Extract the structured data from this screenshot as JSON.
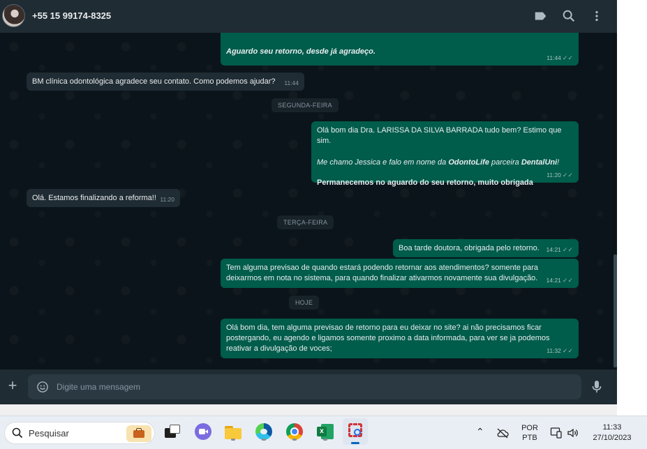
{
  "header": {
    "contact_name": "+55 15 99174-8325",
    "icons": [
      "label-icon",
      "search-icon",
      "menu-icon"
    ]
  },
  "messages": [
    {
      "dir": "out",
      "lines": [
        "Aguardo seu retorno, desde já agradeço."
      ],
      "time": "11:44"
    },
    {
      "dir": "in",
      "text": "BM clínica odontológica agradece seu contato. Como podemos ajudar?",
      "time": "11:44"
    },
    {
      "dir": "date",
      "text": "SEGUNDA-FEIRA"
    },
    {
      "dir": "out",
      "line1": "Olá bom dia Dra. LARISSA DA SILVA BARRADA tudo bem? Estimo que sim.",
      "line2_a": "Me chamo Jessica e falo em nome da ",
      "line2_b": "OdontoLife",
      "line2_c": " parceira ",
      "line2_d": "DentalUni",
      "line2_e": "!",
      "line3": "Permanecemos no aguardo do seu retorno, muito obrigada",
      "time": "11:20"
    },
    {
      "dir": "in",
      "text": "Olá. Estamos finalizando a reforma!!",
      "time": "11:20"
    },
    {
      "dir": "date",
      "text": "TERÇA-FEIRA"
    },
    {
      "dir": "out",
      "text": "Boa tarde doutora, obrigada pelo retorno.",
      "time": "14:21"
    },
    {
      "dir": "out",
      "line1": "Tem alguma previsao de quando estará podendo retornar aos atendimentos? somente para",
      "line2": "deixarmos em nota no sistema, para quando finalizar ativarmos novamente sua divulgação.",
      "time": "14:21"
    },
    {
      "dir": "date",
      "text": "HOJE"
    },
    {
      "dir": "out",
      "line1": "Olá bom dia, tem alguma previsao de retorno para eu deixar no site? ai não precisamos ficar",
      "line2": "postergando, eu agendo e ligamos somente proximo a data informada, para ver se ja podemos",
      "line3": "reativar a divulgação de voces;",
      "time": "11:32"
    }
  ],
  "composer": {
    "placeholder": "Digite uma mensagem",
    "icons": [
      "plus-icon",
      "emoji-icon",
      "mic-icon"
    ]
  },
  "taskbar": {
    "search_label": "Pesquisar",
    "language_line1": "POR",
    "language_line2": "PTB",
    "time": "11:33",
    "date": "27/10/2023"
  },
  "colors": {
    "app_bg": "#0b141a",
    "header_bg": "#202c33",
    "incoming_bubble": "#202c33",
    "outgoing_bubble": "#005c4b",
    "taskbar_bg": "#e9eef5"
  }
}
